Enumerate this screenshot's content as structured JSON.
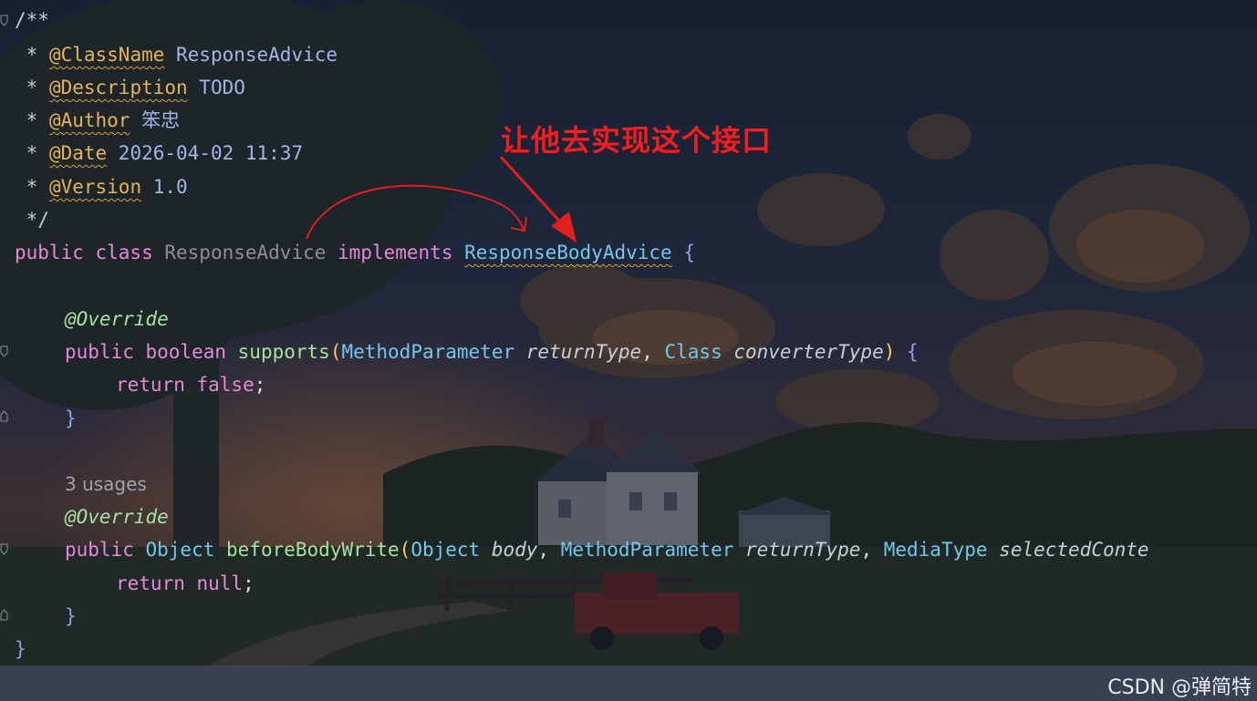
{
  "editor": {
    "lines": {
      "c1": "/**",
      "c2_star": " * ",
      "c2_tag": "@ClassName",
      "c2_val": " ResponseAdvice",
      "c3_star": " * ",
      "c3_tag": "@Description",
      "c3_val": " TODO",
      "c4_star": " * ",
      "c4_tag": "@Author",
      "c4_val": " 笨忠",
      "c5_star": " * ",
      "c5_tag": "@Date",
      "c5_val": " 2026-04-02 11:37",
      "c6_star": " * ",
      "c6_tag": "@Version",
      "c6_val": " 1.0",
      "c7": " */",
      "decl_public": "public",
      "decl_class": " class ",
      "decl_name": "ResponseAdvice",
      "decl_impl": " implements ",
      "decl_iface": "ResponseBodyAdvice",
      "decl_brace": " {",
      "ann1": "@Override",
      "m1_public": "public",
      "m1_type": " boolean ",
      "m1_name": "supports",
      "m1_open": "(",
      "m1_p1type": "MethodParameter",
      "m1_p1name": " returnType",
      "m1_comma": ", ",
      "m1_p2type": "Class",
      "m1_p2name": " converterType",
      "m1_close": ")",
      "m1_brace": " {",
      "m1_ret": "return",
      "m1_retval": " false",
      "m1_semi": ";",
      "m1_end": "}",
      "usages": "3 usages",
      "ann2": "@Override",
      "m2_public": "public",
      "m2_type": " Object",
      "m2_name": " beforeBodyWrite",
      "m2_open": "(",
      "m2_p1type": "Object",
      "m2_p1name": " body",
      "m2_comma1": ", ",
      "m2_p2type": "MethodParameter",
      "m2_p2name": " returnType",
      "m2_comma2": ", ",
      "m2_p3type": "MediaType",
      "m2_p3name": " selectedConte",
      "m2_ret": "return",
      "m2_retval": " null",
      "m2_semi": ";",
      "m2_end": "}",
      "class_end": "}"
    }
  },
  "annotation": {
    "text": "让他去实现这个接口",
    "color": "#f01e1e"
  },
  "watermark": "CSDN @弹简特",
  "colors": {
    "keyword": "#e589d6",
    "type": "#74c7ec",
    "function": "#a6e3a1",
    "javadoc_tag": "#e5b35a"
  }
}
